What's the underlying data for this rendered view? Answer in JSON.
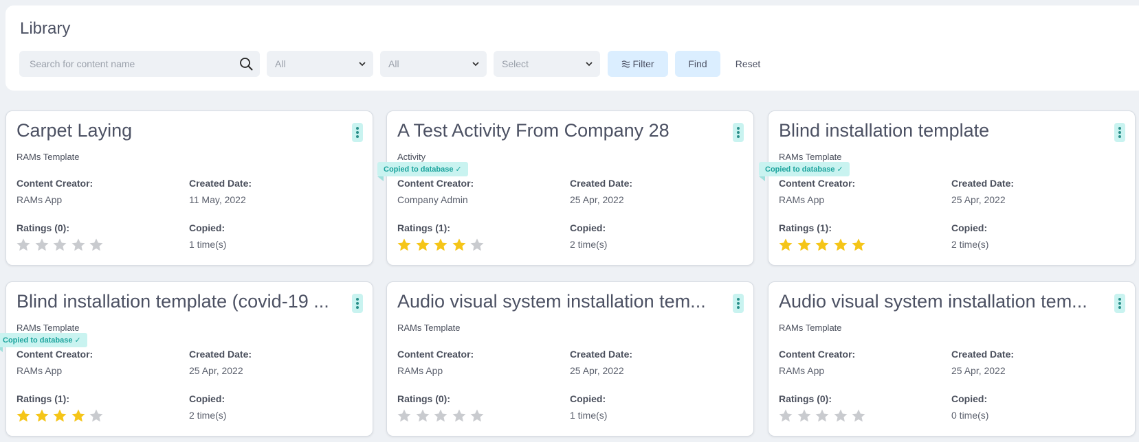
{
  "library": {
    "title": "Library",
    "search_placeholder": "Search for content name",
    "select1": "All",
    "select2": "All",
    "select3": "Select",
    "filter_label": "Filter",
    "find_label": "Find",
    "reset_label": "Reset"
  },
  "labels": {
    "creator": "Content Creator:",
    "date": "Created Date:",
    "copied_label": "Copied:"
  },
  "colors": {
    "star_on": "#f5c518",
    "star_off": "#c9cbcf",
    "badge_bg": "#c9f3f0",
    "badge_text": "#1aa39c"
  },
  "cards": [
    {
      "title": "Carpet Laying",
      "type": "RAMs Template",
      "creator": "RAMs App",
      "date": "11 May, 2022",
      "ratings": "Ratings (0):",
      "stars": 0,
      "copied": "1 time(s)",
      "badge": ""
    },
    {
      "title": "A Test Activity From Company 28",
      "type": "Activity",
      "creator": "Company Admin",
      "date": "25 Apr, 2022",
      "ratings": "Ratings (1):",
      "stars": 4,
      "copied": "2 time(s)",
      "badge": "Copied to database ✓"
    },
    {
      "title": "Blind installation template",
      "type": "RAMs Template",
      "creator": "RAMs App",
      "date": "25 Apr, 2022",
      "ratings": "Ratings (1):",
      "stars": 5,
      "copied": "2 time(s)",
      "badge": "Copied to database ✓"
    },
    {
      "title": "Blind installation template (covid-19 ...",
      "type": "RAMs Template",
      "creator": "RAMs App",
      "date": "25 Apr, 2022",
      "ratings": "Ratings (1):",
      "stars": 4,
      "copied": "2 time(s)",
      "badge": "Copied to database ✓"
    },
    {
      "title": "Audio visual system installation tem...",
      "type": "RAMs Template",
      "creator": "RAMs App",
      "date": "25 Apr, 2022",
      "ratings": "Ratings (0):",
      "stars": 0,
      "copied": "1 time(s)",
      "badge": ""
    },
    {
      "title": "Audio visual system installation tem...",
      "type": "RAMs Template",
      "creator": "RAMs App",
      "date": "25 Apr, 2022",
      "ratings": "Ratings (0):",
      "stars": 0,
      "copied": "0 time(s)",
      "badge": ""
    }
  ]
}
